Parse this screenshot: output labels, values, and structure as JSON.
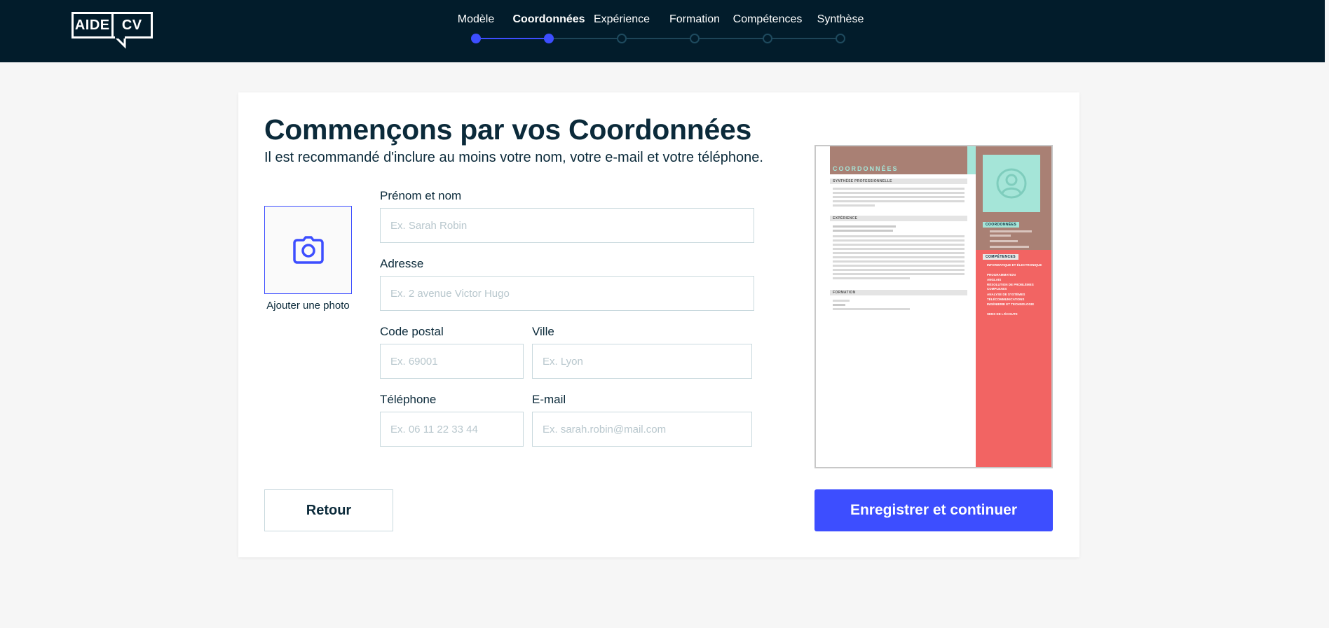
{
  "header": {
    "logo": {
      "left": "AIDE",
      "right": "CV"
    },
    "steps": [
      {
        "label": "Modèle",
        "state": "done"
      },
      {
        "label": "Coordonnées",
        "state": "active"
      },
      {
        "label": "Expérience",
        "state": "todo"
      },
      {
        "label": "Formation",
        "state": "todo"
      },
      {
        "label": "Compétences",
        "state": "todo"
      },
      {
        "label": "Synthèse",
        "state": "todo"
      }
    ]
  },
  "page": {
    "title": "Commençons par vos Coordonnées",
    "subtitle": "Il est recommandé d'inclure au moins votre nom, votre e-mail et votre téléphone.",
    "photo_label": "Ajouter une photo"
  },
  "form": {
    "name": {
      "label": "Prénom et nom",
      "placeholder": "Ex. Sarah Robin",
      "value": ""
    },
    "address": {
      "label": "Adresse",
      "placeholder": "Ex. 2 avenue Victor Hugo",
      "value": ""
    },
    "postal": {
      "label": "Code postal",
      "placeholder": "Ex. 69001",
      "value": ""
    },
    "city": {
      "label": "Ville",
      "placeholder": "Ex. Lyon",
      "value": ""
    },
    "phone": {
      "label": "Téléphone",
      "placeholder": "Ex. 06 11 22 33 44",
      "value": ""
    },
    "email": {
      "label": "E-mail",
      "placeholder": "Ex. sarah.robin@mail.com",
      "value": ""
    }
  },
  "buttons": {
    "back": "Retour",
    "next": "Enregistrer et continuer"
  },
  "cv_preview": {
    "header_title": "COORDONNÉES",
    "section_summary": "SYNTHÈSE PROFESSIONNELLE",
    "section_experience": "EXPÉRIENCE",
    "section_education": "FORMATION",
    "side_contact_heading": "COORDONNÉES",
    "side_skills_heading": "COMPÉTENCES",
    "skills": [
      "INFORMATIQUE ET ÉLECTRONIQUE",
      "PROGRAMMATION",
      "ANGLAIS",
      "RÉSOLUTION DE PROBLÈMES COMPLEXES",
      "ANALYSE DE SYSTÈMES",
      "TÉLÉCOMMUNICATIONS",
      "INGÉNIERIE ET TECHNOLOGIE",
      "SENS DE L'ÉCOUTE"
    ]
  },
  "colors": {
    "header_bg": "#021c2b",
    "accent": "#3d4eff",
    "cv_brown": "#a98074",
    "cv_teal": "#a5e5d8",
    "cv_red": "#f26463"
  },
  "icons": {
    "photo": "camera-icon",
    "avatar": "user-avatar-icon"
  }
}
